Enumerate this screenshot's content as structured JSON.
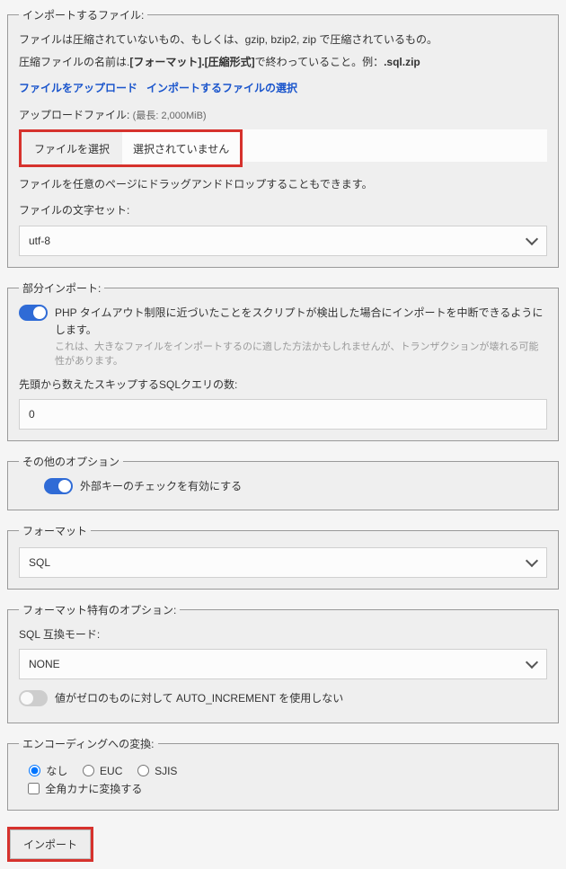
{
  "import_file": {
    "legend": "インポートするファイル:",
    "desc_line1_a": "ファイルは圧縮されていないもの、もしくは、gzip, bzip2, zip で圧縮されているもの。",
    "desc_line2_prefix": "圧縮ファイルの名前は.",
    "desc_line2_bold1": "[フォーマット].[圧縮形式]",
    "desc_line2_mid": "で終わっていること。例：",
    "desc_line2_bold2": ".sql.zip",
    "upload_link_1": "ファイルをアップロード",
    "upload_link_2": "インポートするファイルの選択",
    "upload_label": "アップロードファイル: ",
    "upload_limit": "(最長: 2,000MiB)",
    "choose_button": "ファイルを選択",
    "file_status": "選択されていません",
    "drag_note": "ファイルを任意のページにドラッグアンドドロップすることもできます。",
    "charset_label": "ファイルの文字セット:",
    "charset_value": "utf-8"
  },
  "partial": {
    "legend": "部分インポート:",
    "toggle_label": "PHP タイムアウト制限に近づいたことをスクリプトが検出した場合にインポートを中断できるようにします。",
    "toggle_help": "これは、大きなファイルをインポートするのに適した方法かもしれませんが、トランザクションが壊れる可能性があります。",
    "skip_label": "先頭から数えたスキップするSQLクエリの数:",
    "skip_value": "0"
  },
  "other": {
    "legend": "その他のオプション",
    "fk_label": "外部キーのチェックを有効にする"
  },
  "format": {
    "legend": "フォーマット",
    "value": "SQL"
  },
  "format_options": {
    "legend": "フォーマット特有のオプション:",
    "compat_label": "SQL 互換モード:",
    "compat_value": "NONE",
    "ai_zero_label": "値がゼロのものに対して AUTO_INCREMENT を使用しない"
  },
  "encoding": {
    "legend": "エンコーディングへの変換:",
    "none": "なし",
    "euc": "EUC",
    "sjis": "SJIS",
    "zenkaku": "全角カナに変換する"
  },
  "submit": "インポート"
}
